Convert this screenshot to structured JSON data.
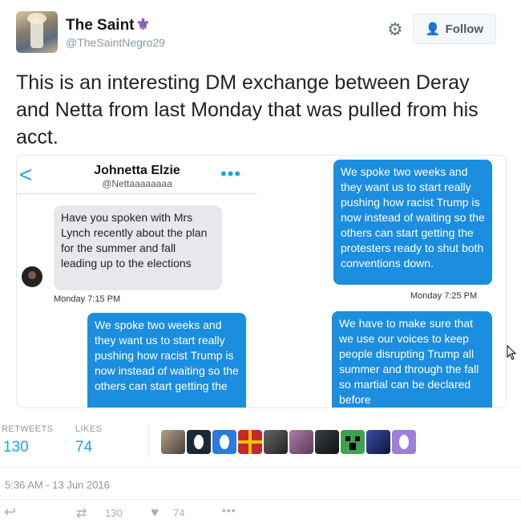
{
  "tweet": {
    "author_name": "The Saint",
    "author_handle": "@TheSaintNegro29",
    "follow_label": "Follow",
    "text": "This is an interesting DM exchange between Deray and Netta from last Monday that was pulled from his acct."
  },
  "dm": {
    "back_glyph": "<",
    "name": "Johnetta Elzie",
    "handle": "@Nettaaaaaaaa",
    "more_glyph": "•••",
    "left_gray": "Have you spoken with Mrs Lynch recently about the plan for the summer and fall leading up to the elections",
    "left_time": "Monday 7:15 PM",
    "left_blue": "We spoke two weeks and they want us to start really pushing how racist Trump is now  instead of waiting so the others can start getting the",
    "right_blue_1": "We spoke two weeks and they want us to start really pushing how racist Trump is now  instead of waiting so the others can start getting the protesters ready to shut both conventions down.",
    "right_time": "Monday 7:25 PM",
    "right_blue_2": "We have to make sure that we use our voices to keep people disrupting Trump all summer and through the fall so martial can be declared before"
  },
  "stats": {
    "retweets_label": "RETWEETS",
    "retweets_value": "130",
    "likes_label": "LIKES",
    "likes_value": "74"
  },
  "timestamp": "5:36 AM - 13 Jun 2016",
  "actions": {
    "retweet_count": "130",
    "like_count": "74"
  },
  "icons": [
    "settings-gear-icon",
    "follow-person-icon",
    "reply-icon",
    "retweet-icon",
    "heart-icon",
    "more-dots-icon",
    "cursor-icon"
  ],
  "colors": {
    "accent": "#1da1f2",
    "dm_blue": "#1b8ee0",
    "dm_gray": "#e6e8ec",
    "muted": "#8899a6",
    "name_emblem": "#7e5bb0"
  }
}
